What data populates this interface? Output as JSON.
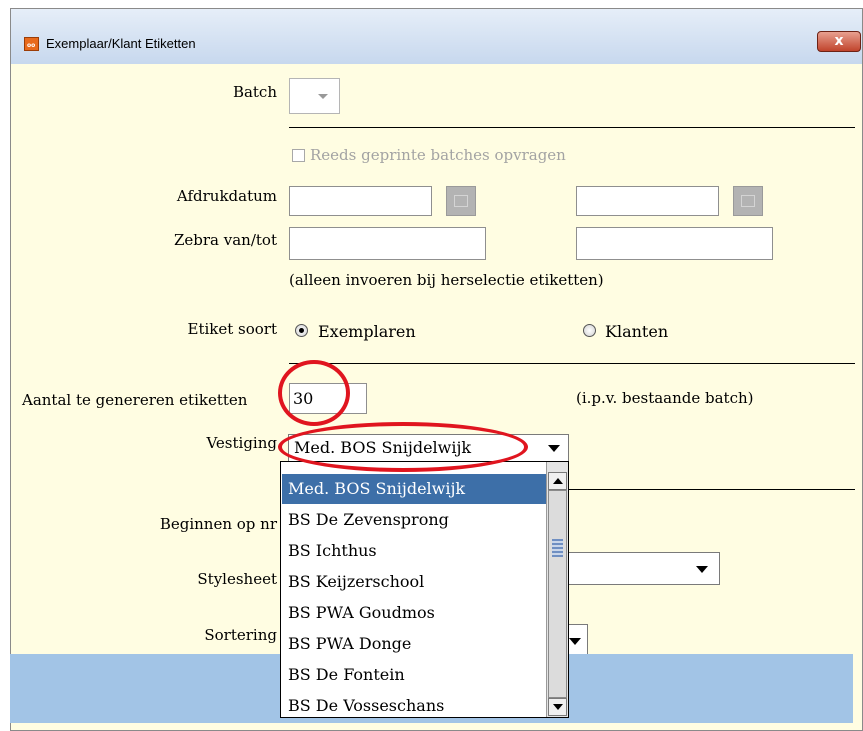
{
  "window": {
    "title": "Exemplaar/Klant Etiketten",
    "icon": "app-icon",
    "close_label": "x"
  },
  "form": {
    "batch_label": "Batch",
    "reeds_label": "Reeds geprinte batches opvragen",
    "afdrukdatum_label": "Afdrukdatum",
    "afdrukdatum_van": "",
    "afdrukdatum_tot": "",
    "zebra_label": "Zebra van/tot",
    "zebra_van": "",
    "zebra_tot": "",
    "zebra_hint": "(alleen invoeren bij herselectie etiketten)",
    "etiket_label": "Etiket soort",
    "radio_exemplaren": "Exemplaren",
    "radio_klanten": "Klanten",
    "selected_soort": "Exemplaren",
    "aantal_label": "Aantal te genereren etiketten",
    "aantal_value": "30",
    "aantal_hint": "(i.p.v. bestaande batch)",
    "vestiging_label": "Vestiging",
    "vestiging_value": "Med. BOS Snijdelwijk",
    "beginnen_label": "Beginnen op nr",
    "stylesheet_label": "Stylesheet",
    "sortering_label": "Sortering"
  },
  "dropdown": {
    "options": [
      "Med. BOS Snijdelwijk",
      "BS De Zevensprong",
      "BS Ichthus",
      "BS Keijzerschool",
      "BS PWA Goudmos",
      "BS PWA Donge",
      "BS De Fontein",
      "BS De Vosseschans"
    ],
    "selected": "Med. BOS Snijdelwijk"
  },
  "annotation_color": "#e0151f"
}
